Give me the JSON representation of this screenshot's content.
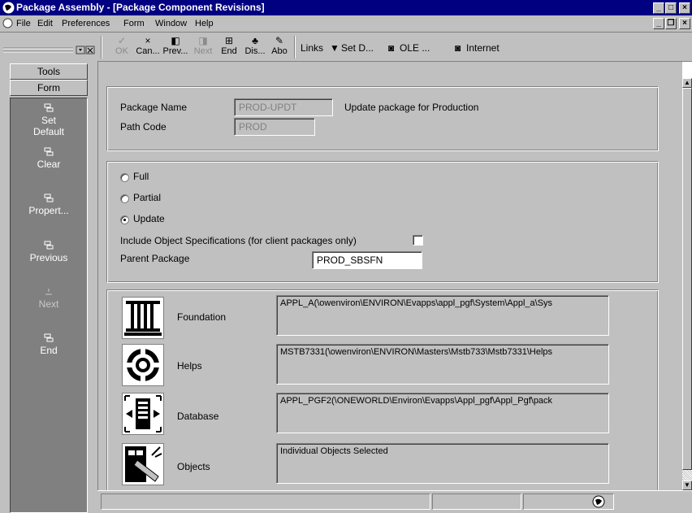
{
  "window": {
    "title": "Package Assembly - [Package Component Revisions]"
  },
  "menu": {
    "items": [
      {
        "label": "File",
        "key": "F"
      },
      {
        "label": "Edit",
        "key": "E"
      },
      {
        "label": "Preferences",
        "key": "P"
      },
      {
        "label": "Form",
        "key": "m"
      },
      {
        "label": "Window",
        "key": "W"
      },
      {
        "label": "Help",
        "key": "H"
      }
    ]
  },
  "tools_panel": {
    "tools_label": "Tools",
    "form_label": "Form",
    "items": [
      {
        "label": "Set Default",
        "line1": "Set",
        "line2": "Default"
      },
      {
        "label": "Clear"
      },
      {
        "label": "Propert..."
      },
      {
        "label": "Previous"
      },
      {
        "label": "Next"
      },
      {
        "label": "End"
      }
    ]
  },
  "toolbar": {
    "buttons": [
      {
        "label": "OK",
        "icon": "check-icon",
        "glyph": "✓"
      },
      {
        "label": "Can...",
        "icon": "x-icon",
        "glyph": "×"
      },
      {
        "label": "Prev...",
        "icon": "prev-icon",
        "glyph": "◧"
      },
      {
        "label": "Next",
        "icon": "next-icon",
        "glyph": "◨"
      },
      {
        "label": "End",
        "icon": "end-icon",
        "glyph": "⊞"
      },
      {
        "label": "Dis...",
        "icon": "display-icon",
        "glyph": "♣"
      },
      {
        "label": "Abo",
        "icon": "about-icon",
        "glyph": "✎"
      }
    ],
    "links_label": "Links",
    "set_d_label": "Set D...",
    "ole_label": "OLE ...",
    "internet_label": "Internet"
  },
  "header_section": {
    "package_name_label": "Package Name",
    "package_name_value": "PROD-UPDT",
    "package_description": "Update package for Production",
    "path_code_label": "Path Code",
    "path_code_value": "PROD"
  },
  "type_section": {
    "options": [
      {
        "label": "Full",
        "checked": false
      },
      {
        "label": "Partial",
        "checked": false
      },
      {
        "label": "Update",
        "checked": true
      }
    ],
    "include_specs_label": "Include Object Specifications (for client packages only)",
    "include_specs_checked": false,
    "parent_package_label": "Parent Package",
    "parent_package_value": "PROD_SBSFN"
  },
  "components": [
    {
      "name": "Foundation",
      "icon": "foundation-icon",
      "path": "APPL_A(\\owenviron\\ENVIRON\\Evapps\\appl_pgf\\System\\Appl_a\\Sys"
    },
    {
      "name": "Helps",
      "icon": "helps-icon",
      "path": "MSTB7331(\\owenviron\\ENVIRON\\Masters\\Mstb733\\Mstb7331\\Helps"
    },
    {
      "name": "Database",
      "icon": "database-icon",
      "path": "APPL_PGF2(\\ONEWORLD\\Environ\\Evapps\\Appl_pgf\\Appl_Pgf\\pack"
    },
    {
      "name": "Objects",
      "icon": "objects-icon",
      "path": "Individual Objects Selected"
    }
  ]
}
